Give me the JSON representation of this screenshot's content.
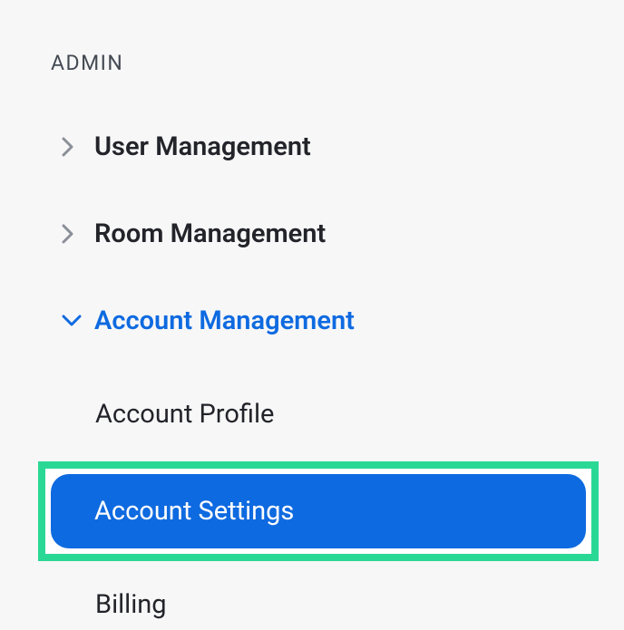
{
  "section_title": "ADMIN",
  "nav": {
    "items": [
      {
        "label": "User Management",
        "expanded": false
      },
      {
        "label": "Room Management",
        "expanded": false
      },
      {
        "label": "Account Management",
        "expanded": true,
        "children": [
          {
            "label": "Account Profile",
            "selected": false,
            "highlighted": false
          },
          {
            "label": "Account Settings",
            "selected": true,
            "highlighted": true
          },
          {
            "label": "Billing",
            "selected": false,
            "highlighted": false
          }
        ]
      }
    ]
  },
  "colors": {
    "accent": "#0e6ae0",
    "highlight_frame": "#2ad895",
    "background": "#f7f7f8",
    "text_primary": "#23242a"
  }
}
